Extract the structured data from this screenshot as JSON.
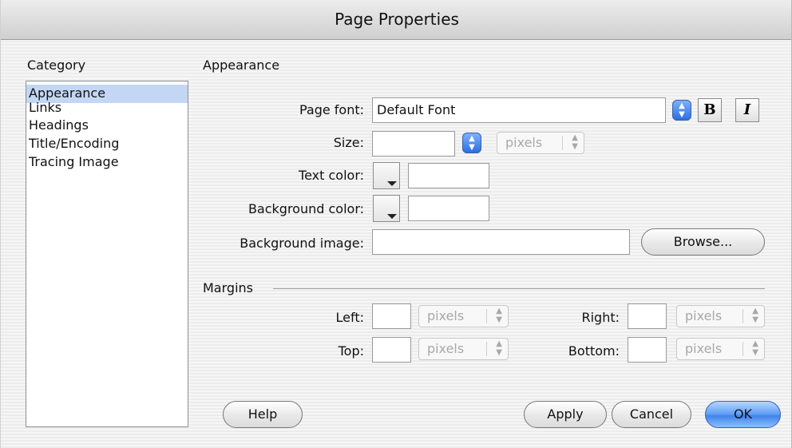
{
  "window": {
    "title": "Page Properties"
  },
  "category": {
    "heading": "Category",
    "items": [
      "Appearance",
      "Links",
      "Headings",
      "Title/Encoding",
      "Tracing Image"
    ],
    "selected": "Appearance"
  },
  "appearance": {
    "heading": "Appearance",
    "page_font": {
      "label": "Page font:",
      "value": "Default Font",
      "bold_label": "B",
      "italic_label": "I"
    },
    "size": {
      "label": "Size:",
      "value": "",
      "unit": "pixels"
    },
    "text_color": {
      "label": "Text color:",
      "value": ""
    },
    "background_color": {
      "label": "Background color:",
      "value": ""
    },
    "background_image": {
      "label": "Background image:",
      "value": "",
      "browse_label": "Browse..."
    }
  },
  "margins": {
    "heading": "Margins",
    "left": {
      "label": "Left:",
      "value": "",
      "unit": "pixels"
    },
    "right": {
      "label": "Right:",
      "value": "",
      "unit": "pixels"
    },
    "top": {
      "label": "Top:",
      "value": "",
      "unit": "pixels"
    },
    "bottom": {
      "label": "Bottom:",
      "value": "",
      "unit": "pixels"
    }
  },
  "buttons": {
    "help": "Help",
    "apply": "Apply",
    "cancel": "Cancel",
    "ok": "OK"
  },
  "icons": {
    "dropdown": "up-down-arrows-icon",
    "swatch": "color-swatch-icon"
  },
  "colors": {
    "selection": "#c3d7f5",
    "accent": "#3e82ea"
  }
}
